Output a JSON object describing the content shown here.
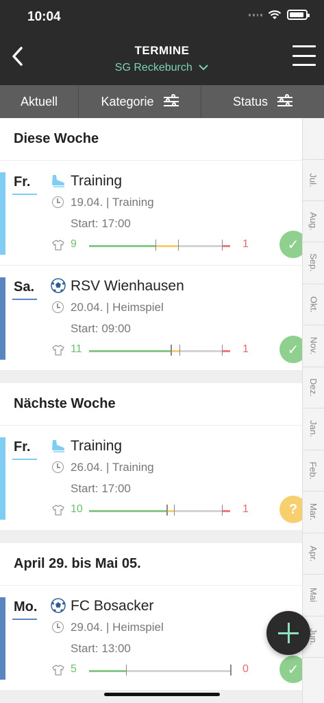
{
  "status_bar": {
    "time": "10:04"
  },
  "header": {
    "title": "TERMINE",
    "subtitle": "SG Reckeburch"
  },
  "filters": [
    {
      "label": "Aktuell"
    },
    {
      "label": "Kategorie"
    },
    {
      "label": "Status"
    }
  ],
  "sections": [
    {
      "title": "Diese Woche",
      "events": [
        {
          "day": "Fr.",
          "type": "training",
          "title": "Training",
          "date_line": "19.04. | Training",
          "start": "Start: 17:00",
          "yes": "9",
          "no": "1",
          "status": "confirmed",
          "bar_color": "#7fcdf2",
          "dist": {
            "yes": 0.47,
            "maybe": 0.16,
            "open": 0.31,
            "no": 0.06
          }
        },
        {
          "day": "Sa.",
          "type": "match",
          "title": "RSV Wienhausen",
          "date_line": "20.04. | Heimspiel",
          "start": "Start: 09:00",
          "yes": "11",
          "no": "1",
          "status": "confirmed",
          "bar_color": "#5a86c0",
          "dist": {
            "yes": 0.58,
            "maybe": 0.06,
            "open": 0.3,
            "no": 0.06
          }
        }
      ]
    },
    {
      "title": "Nächste Woche",
      "events": [
        {
          "day": "Fr.",
          "type": "training",
          "title": "Training",
          "date_line": "26.04. | Training",
          "start": "Start: 17:00",
          "yes": "10",
          "no": "1",
          "status": "pending",
          "bar_color": "#7fcdf2",
          "dist": {
            "yes": 0.55,
            "maybe": 0.05,
            "open": 0.34,
            "no": 0.06
          }
        }
      ]
    },
    {
      "title": "April 29. bis Mai 05.",
      "events": [
        {
          "day": "Mo.",
          "type": "match",
          "title": "FC Bosacker",
          "date_line": "29.04. | Heimspiel",
          "start": "Start: 13:00",
          "yes": "5",
          "no": "0",
          "status": "confirmed",
          "bar_color": "#5a86c0",
          "dist": {
            "yes": 0.26,
            "maybe": 0.0,
            "open": 0.74,
            "no": 0.0
          }
        }
      ]
    }
  ],
  "months": [
    "Jul.",
    "Aug.",
    "Sep.",
    "Okt.",
    "Nov.",
    "Dez.",
    "Jan.",
    "Feb.",
    "Mar.",
    "Apr.",
    "Mai",
    "Jun."
  ],
  "colors": {
    "yes": "#86c986",
    "maybe": "#f7cf6f",
    "open": "#d3d3d3",
    "no": "#ef7a7a",
    "confirmed": "#8fd08f",
    "pending": "#f7cf6f"
  },
  "badge_symbols": {
    "confirmed": "✓",
    "pending": "?"
  }
}
